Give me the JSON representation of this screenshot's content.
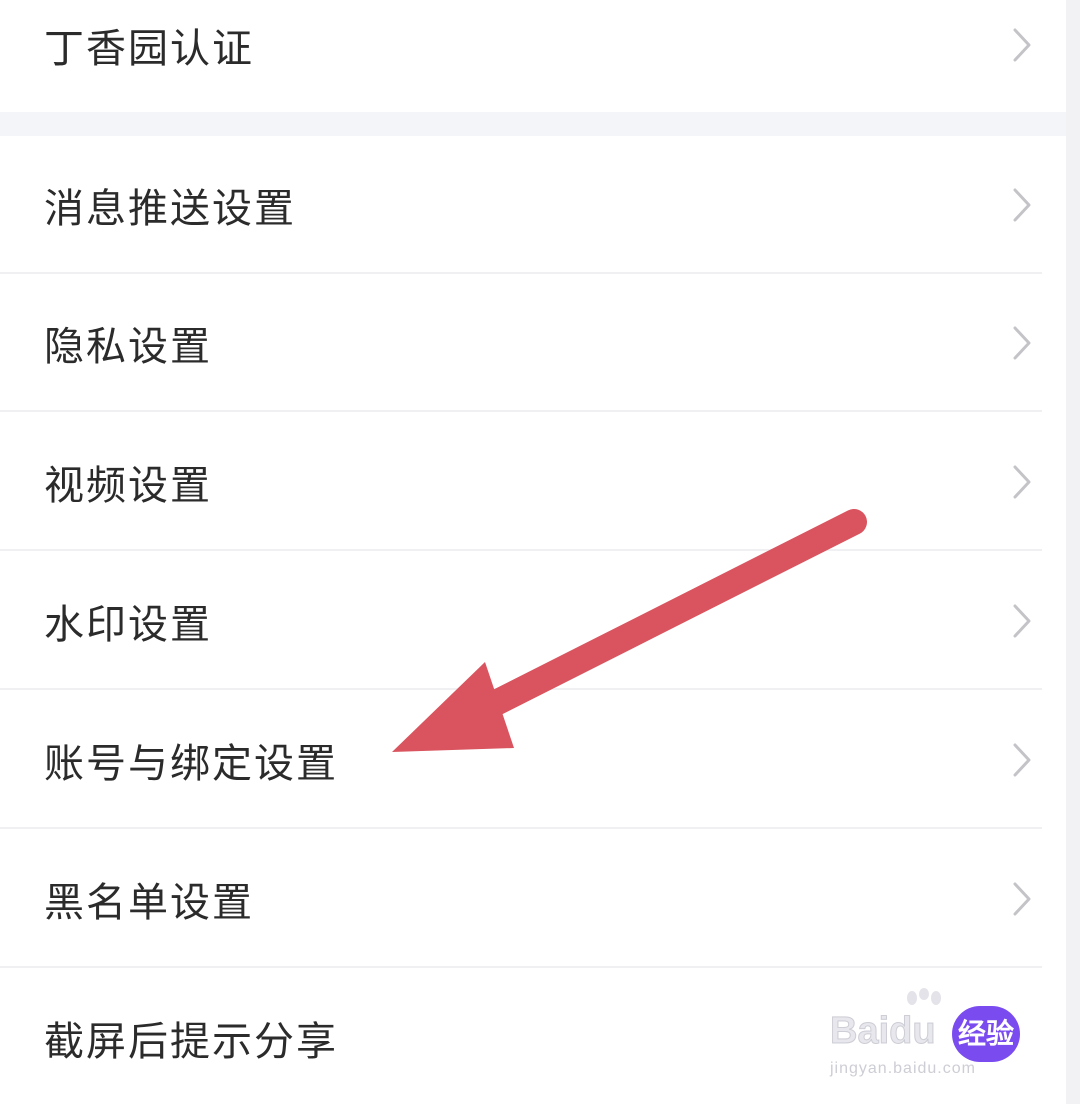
{
  "settings": {
    "items": [
      {
        "label": "丁香园认证"
      },
      {
        "label": "消息推送设置"
      },
      {
        "label": "隐私设置"
      },
      {
        "label": "视频设置"
      },
      {
        "label": "水印设置"
      },
      {
        "label": "账号与绑定设置"
      },
      {
        "label": "黑名单设置"
      },
      {
        "label": "截屏后提示分享"
      }
    ]
  },
  "watermark": {
    "brand": "Baidu",
    "badge": "经验",
    "url": "jingyan.baidu.com"
  },
  "colors": {
    "text": "#2b2b2b",
    "chevron": "#c4c4c8",
    "divider": "#f0f0f2",
    "section_gap": "#f4f5f9",
    "annotation_arrow": "#d9545e",
    "badge": "#7a4cf0"
  },
  "icons": {
    "row_chevron": "chevron-right-icon",
    "annotation": "annotation-arrow"
  }
}
